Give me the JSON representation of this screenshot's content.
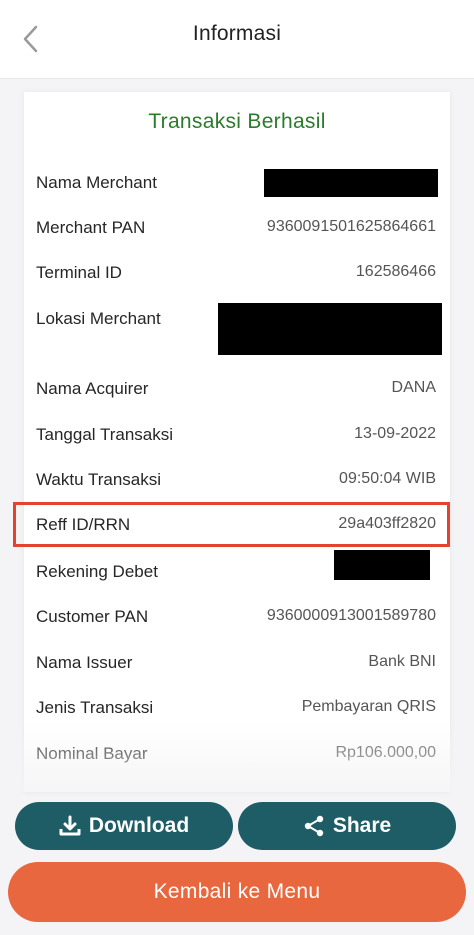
{
  "header": {
    "title": "Informasi",
    "back_icon": "chevron-left-icon"
  },
  "card": {
    "title": "Transaksi Berhasil",
    "rows": [
      {
        "label": "Nama Merchant",
        "value": ""
      },
      {
        "label": "Merchant PAN",
        "value": "936009150162586466​1"
      },
      {
        "label": "Terminal ID",
        "value": "162586466"
      },
      {
        "label": "Lokasi Merchant",
        "value": ""
      },
      {
        "label": "Nama Acquirer",
        "value": "DANA"
      },
      {
        "label": "Tanggal Transaksi",
        "value": "13-09-2022"
      },
      {
        "label": "Waktu Transaksi",
        "value": "09:50:04 WIB"
      },
      {
        "label": "Reff ID/RRN",
        "value": "29a403ff2820"
      },
      {
        "label": "Rekening Debet",
        "value": ""
      },
      {
        "label": "Customer PAN",
        "value": "9360000913001589780"
      },
      {
        "label": "Nama Issuer",
        "value": "Bank BNI"
      },
      {
        "label": "Jenis Transaksi",
        "value": "Pembayaran QRIS"
      },
      {
        "label": "Nominal Bayar",
        "value": "Rp106.000,00"
      }
    ]
  },
  "actions": {
    "download_label": "Download",
    "share_label": "Share",
    "back_menu_label": "Kembali ke Menu"
  },
  "colors": {
    "success_title": "#2d7a2d",
    "dark_button": "#1e5c66",
    "main_button": "#e9673f",
    "highlight": "#e5432f"
  }
}
